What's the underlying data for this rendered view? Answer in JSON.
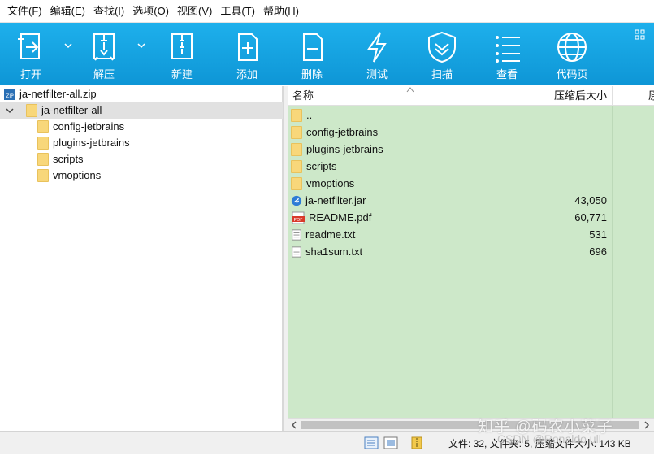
{
  "menu": [
    "文件(F)",
    "编辑(E)",
    "查找(I)",
    "选项(O)",
    "视图(V)",
    "工具(T)",
    "帮助(H)"
  ],
  "toolbar": {
    "buttons": [
      {
        "label": "打开",
        "icon": "open-icon"
      },
      {
        "label": "解压",
        "icon": "extract-icon"
      },
      {
        "label": "新建",
        "icon": "new-archive-icon"
      },
      {
        "label": "添加",
        "icon": "add-icon"
      },
      {
        "label": "删除",
        "icon": "delete-icon"
      },
      {
        "label": "测试",
        "icon": "test-icon"
      },
      {
        "label": "扫描",
        "icon": "scan-icon"
      },
      {
        "label": "查看",
        "icon": "view-icon"
      },
      {
        "label": "代码页",
        "icon": "codepage-icon"
      }
    ],
    "color": "#1aa7e4"
  },
  "tree": {
    "archive": "ja-netfilter-all.zip",
    "root": "ja-netfilter-all",
    "children": [
      "config-jetbrains",
      "plugins-jetbrains",
      "scripts",
      "vmoptions"
    ]
  },
  "list": {
    "columns": [
      "名称",
      "压缩后大小",
      "原"
    ],
    "rows": [
      {
        "name": "..",
        "type": "folder",
        "size": ""
      },
      {
        "name": "config-jetbrains",
        "type": "folder",
        "size": ""
      },
      {
        "name": "plugins-jetbrains",
        "type": "folder",
        "size": ""
      },
      {
        "name": "scripts",
        "type": "folder",
        "size": ""
      },
      {
        "name": "vmoptions",
        "type": "folder",
        "size": ""
      },
      {
        "name": "ja-netfilter.jar",
        "type": "jar",
        "size": "43,050"
      },
      {
        "name": "README.pdf",
        "type": "pdf",
        "size": "60,771"
      },
      {
        "name": "readme.txt",
        "type": "txt",
        "size": "531"
      },
      {
        "name": "sha1sum.txt",
        "type": "txt",
        "size": "696"
      }
    ],
    "background": "#cde8c9"
  },
  "status": {
    "text": "文件: 32, 文件夹: 5, 压缩文件大小: 143 KB"
  },
  "watermark": {
    "line1": "知乎 @码农小菜子",
    "line2": "CSDN @Ronaldo ull"
  }
}
